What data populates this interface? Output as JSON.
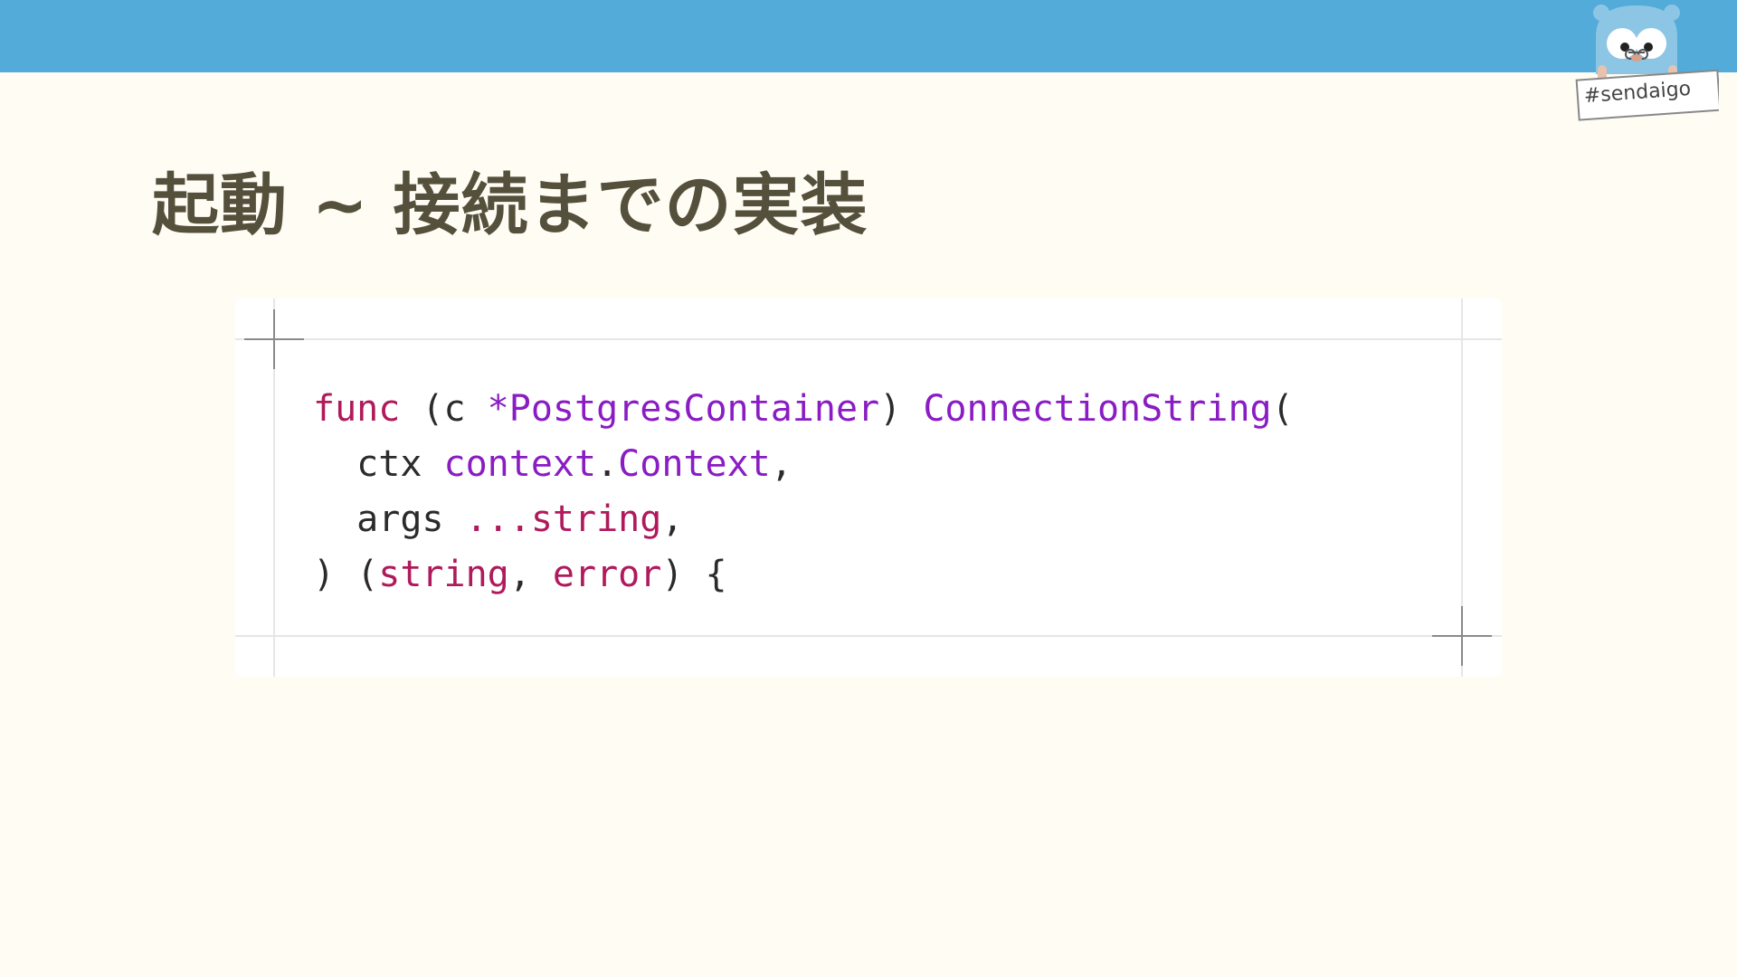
{
  "slide": {
    "title": "起動 ~ 接続までの実装",
    "hashtag": "#sendaigo"
  },
  "code": {
    "language": "go",
    "lines": [
      [
        {
          "t": "func",
          "k": "kw"
        },
        {
          "t": " (c ",
          "k": "pl"
        },
        {
          "t": "*PostgresContainer",
          "k": "ty"
        },
        {
          "t": ") ",
          "k": "pl"
        },
        {
          "t": "ConnectionString",
          "k": "ty"
        },
        {
          "t": "(",
          "k": "pl"
        }
      ],
      [
        {
          "t": "  ctx ",
          "k": "pl"
        },
        {
          "t": "context",
          "k": "ty"
        },
        {
          "t": ".",
          "k": "pl"
        },
        {
          "t": "Context",
          "k": "ty"
        },
        {
          "t": ",",
          "k": "pl"
        }
      ],
      [
        {
          "t": "  args ",
          "k": "pl"
        },
        {
          "t": "...string",
          "k": "kw"
        },
        {
          "t": ",",
          "k": "pl"
        }
      ],
      [
        {
          "t": ") (",
          "k": "pl"
        },
        {
          "t": "string",
          "k": "kw"
        },
        {
          "t": ", ",
          "k": "pl"
        },
        {
          "t": "error",
          "k": "kw"
        },
        {
          "t": ") {",
          "k": "pl"
        }
      ]
    ]
  },
  "colors": {
    "header_bar": "#52abd8",
    "background": "#fffcf4",
    "title": "#54503c",
    "keyword": "#b01a5c",
    "type": "#8a1cc4",
    "plain": "#2b2b2b"
  },
  "icons": {
    "mascot": "go-gopher-mascot-icon"
  }
}
